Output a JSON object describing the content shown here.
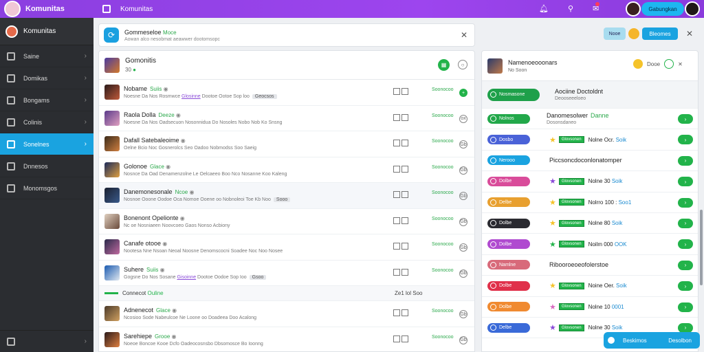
{
  "topbar": {
    "app_title": "Komunitas",
    "crumb": "Komunitas",
    "icons": [
      "bell-icon",
      "pin-icon",
      "gift-icon"
    ],
    "pill": "Gabungkan"
  },
  "sidebar": {
    "header": "Komunitas",
    "items": [
      {
        "label": "Saine"
      },
      {
        "label": "Domikas"
      },
      {
        "label": "Bongams"
      },
      {
        "label": "Colinis"
      },
      {
        "label": "Sonelnes",
        "active": true
      },
      {
        "label": "Dnnesos"
      },
      {
        "label": "Monomsgos"
      }
    ]
  },
  "banner": {
    "title": "Gommeseloe",
    "title_tag": "Moce",
    "subtitle": "Aowan alco nesobmat aeawwer dootomsopc"
  },
  "middle": {
    "header": {
      "title": "Gomonitis",
      "sub": "30"
    },
    "rows": [
      {
        "name": "Nobame",
        "tag": "Suiis",
        "desc": "Noesne Da Nos Rosmwce",
        "link": "Glosinne",
        "desc2": "Dootoe Ootoe Sop loo",
        "chip": "Geocsos",
        "stat": "Soonocoo",
        "act": "+"
      },
      {
        "name": "Raola Dolla",
        "tag": "Deeze",
        "desc": "Noesne Da Nos Oadsecuon Nosonnidua Do Nosoles Nobo Nob Ko Snsng",
        "stat": "Soonocoo",
        "act": "ox"
      },
      {
        "name": "Dafall Satebaleoime",
        "tag": "",
        "desc": "Oelne Bcio Noc Gosnerolcs Seo Oadoo Nobmodss Soo Saeig",
        "stat": "Soonocoo",
        "act": "Gb"
      },
      {
        "name": "Golonoe",
        "tag": "Glace",
        "desc": "Nosnce Da Oad Denamenzolne Le Oelcaeeo Boo Nco Nosanne Koo Kaleng",
        "stat": "Soonocoo",
        "act": "Gb"
      },
      {
        "name": "Danemonesonale",
        "tag": "Ncoe",
        "desc": "Nosnoe Ooone Oodoe Oca Nomoe Ooene oo Nobnoleoi Toe Kb Noo",
        "chip": "Sooo",
        "stat": "Soonocoo",
        "act": "Gb"
      },
      {
        "name": "Bonenont Opelionte",
        "tag": "",
        "desc": "Nc oe Nosniaeen Noovcoeo Gaos Nonso",
        "desc2": "Acbiony",
        "stat": "Soonocoo",
        "act": "Gb"
      },
      {
        "name": "Canafe otooe",
        "tag": "",
        "desc": "Nootesa Nne Nsoan Neoal Noosne Denomscocni Soadee Noc Noo",
        "desc2": "Nosee",
        "stat": "Soonocoo",
        "act": "Gb"
      },
      {
        "name": "Suhere",
        "tag": "Suiis",
        "desc": "Gogsne Do Nos Sosane",
        "link": "Gisoinne",
        "desc2": "Dootoe Oodoe Sop Ioo",
        "chip": "Gsoo",
        "stat": "Soonocoo",
        "act": "Gb"
      }
    ],
    "separator": {
      "label": "Connecot",
      "label_tag": "Ouline",
      "right": "Ze1 lol Soo"
    },
    "rows2": [
      {
        "name": "Adnenecot",
        "tag": "Glace",
        "desc": "Ncosioo Sode Nabeulcoe Ne Loone oo Doadeea Doo Acalong",
        "stat": "Soonocoo",
        "act": "Gb"
      },
      {
        "name": "Sarehiepe",
        "tag": "Grooe",
        "desc": "Noeoe Boncoe Kooe Dcfo Oadeocosnsbo Dbsomosce Bo Ioonng",
        "stat": "Soonocoo",
        "act": "Gb"
      }
    ]
  },
  "right_top": {
    "btn1": "Nooe",
    "btn2": "Bleomes"
  },
  "right": {
    "header": {
      "title": "Namenoeooonars",
      "sub": "No Soon",
      "tag": "Dooe"
    },
    "rows": [
      {
        "kind": "big",
        "pill": "Nosmasone",
        "pill_color": "#1ea04a",
        "title": "Aociine Doctoldnt",
        "sub": "Deooseeeloeo"
      },
      {
        "kind": "mid",
        "pill": "Nolnos",
        "pill_color": "#22a84a",
        "title": "Danomesolwer",
        "title_tag": "Danne",
        "sub": "Dosonsdaneo"
      },
      {
        "kind": "star",
        "pill": "Dosbo",
        "pill_color": "#4a62d8",
        "star": "★",
        "star_color": "#f5c32a",
        "tag": "Glovsonen",
        "name": "Nolne Ocr.",
        "name_tag": "Soik"
      },
      {
        "kind": "one",
        "pill": "Nerooo",
        "pill_color": "#1aa3e0",
        "title": "Piccsoncdoconlonatomper"
      },
      {
        "kind": "star",
        "pill": "Dolbe",
        "pill_color": "#d94c9a",
        "star": "★",
        "star_color": "#8a4bd8",
        "tag": "Glovsonen",
        "name": "Nolne 30",
        "name_tag": "Soik"
      },
      {
        "kind": "star",
        "pill": "Delbe",
        "pill_color": "#e8a030",
        "star": "★",
        "star_color": "#f5c32a",
        "tag": "Glovsonen",
        "name": "Nolrro 100 :",
        "name_tag": "Soo1"
      },
      {
        "kind": "star",
        "pill": "Dolbe",
        "pill_color": "#2a2a30",
        "star": "★",
        "star_color": "#f5c32a",
        "tag": "Glovsonen",
        "name": "Nolne 80",
        "name_tag": "Soik"
      },
      {
        "kind": "star",
        "pill": "Dolbe",
        "pill_color": "#b04ad0",
        "star": "★",
        "star_color": "#22b34a",
        "tag": "Glovsonen",
        "name": "Noilm 000",
        "name_tag": "OOK"
      },
      {
        "kind": "one",
        "pill": "Namlne",
        "pill_color": "#d86a7a",
        "title": "Ribooroeoeofolerstoe"
      },
      {
        "kind": "star",
        "pill": "Dolbe",
        "pill_color": "#e0304a",
        "star": "★",
        "star_color": "#f5c32a",
        "tag": "Glovsonen",
        "name": "Noine Oer.",
        "name_tag": "Soik"
      },
      {
        "kind": "star",
        "pill": "Dolbe",
        "pill_color": "#f08a30",
        "star": "★",
        "star_color": "#d86ac0",
        "tag": "Glovsonen",
        "name": "Nolne 10",
        "name_tag": "0001"
      },
      {
        "kind": "star",
        "pill": "Delbe",
        "pill_color": "#3a6ad8",
        "star": "★",
        "star_color": "#8a4bd8",
        "tag": "Glovsonen",
        "name": "Nolne 30",
        "name_tag": "Soik"
      }
    ]
  },
  "floating": {
    "left": "Beskimos",
    "right": "Desolbon"
  }
}
